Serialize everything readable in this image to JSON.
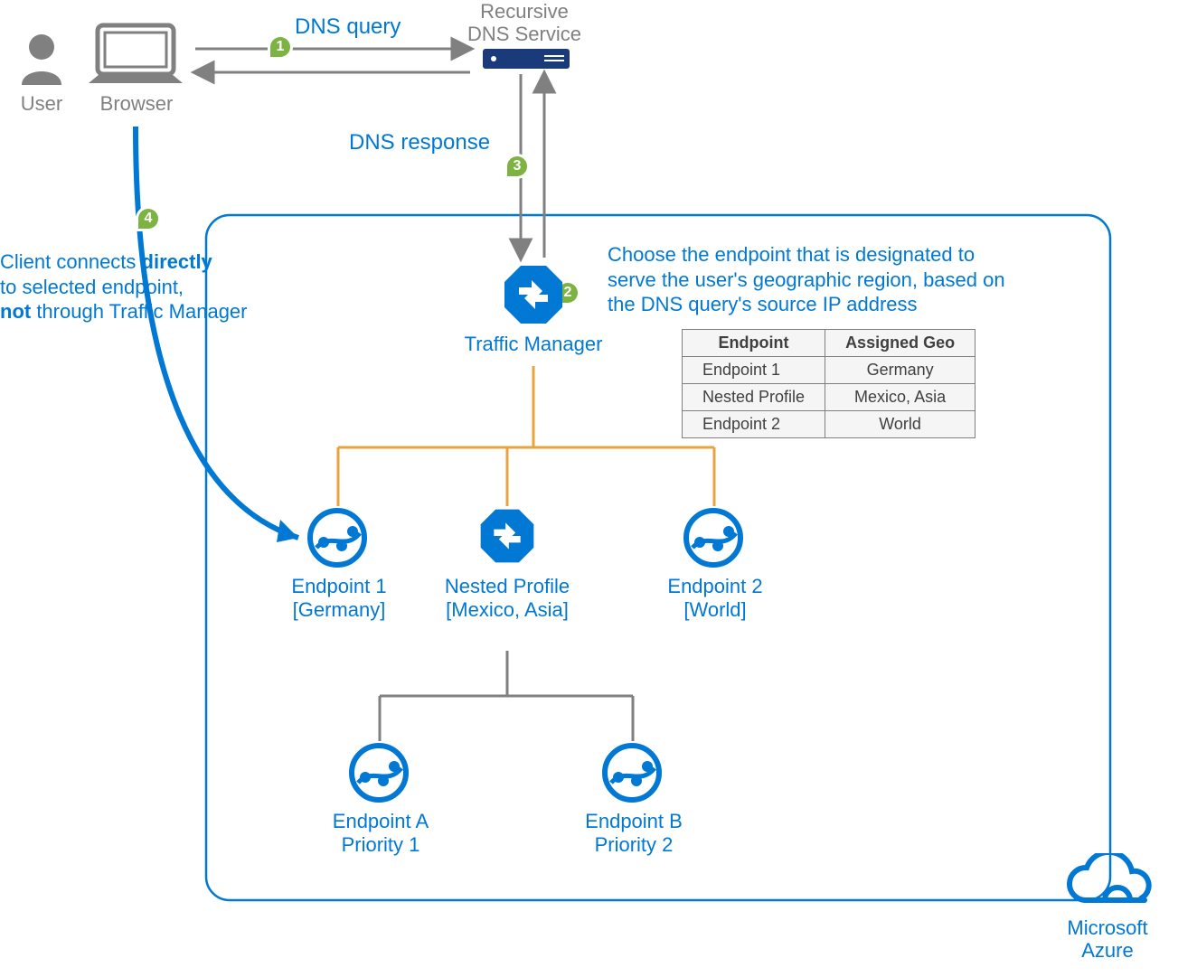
{
  "labels": {
    "user": "User",
    "browser": "Browser",
    "dns_query": "DNS query",
    "dns_response": "DNS response",
    "recursive_dns1": "Recursive",
    "recursive_dns2": "DNS Service",
    "traffic_manager": "Traffic Manager",
    "endpoint1_name": "Endpoint 1",
    "endpoint1_geo": "[Germany]",
    "nested_name": "Nested Profile",
    "nested_geo": "[Mexico, Asia]",
    "endpoint2_name": "Endpoint 2",
    "endpoint2_geo": "[World]",
    "endpointA_name": "Endpoint A",
    "endpointA_pri": "Priority 1",
    "endpointB_name": "Endpoint B",
    "endpointB_pri": "Priority 2",
    "azure1": "Microsoft",
    "azure2": "Azure"
  },
  "steps": {
    "1": "1",
    "2": "2",
    "3": "3",
    "4": "4"
  },
  "callouts": {
    "step2_line1": "Choose the endpoint that is designated to",
    "step2_line2": "serve the user's geographic region, based on",
    "step2_line3": "the DNS query's source IP address",
    "step4_pre": "Client connects ",
    "step4_bold1": "directly",
    "step4_mid": "to selected endpoint,",
    "step4_bold2": "not",
    "step4_post": " through Traffic Manager"
  },
  "table": {
    "headers": [
      "Endpoint",
      "Assigned Geo"
    ],
    "rows": [
      [
        "Endpoint 1",
        "Germany"
      ],
      [
        "Nested Profile",
        "Mexico, Asia"
      ],
      [
        "Endpoint 2",
        "World"
      ]
    ]
  }
}
